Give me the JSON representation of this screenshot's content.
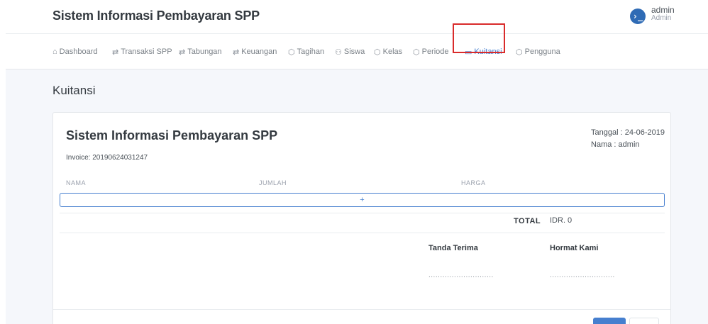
{
  "app": {
    "title": "Sistem Informasi Pembayaran SPP"
  },
  "user": {
    "avatar_glyph": "›_",
    "name": "admin",
    "role": "Admin"
  },
  "nav": {
    "items": [
      {
        "label": "Dashboard",
        "icon": "home-icon",
        "glyph": "⌂"
      },
      {
        "label": "Transaksi SPP",
        "icon": "repeat-icon",
        "glyph": "⇄"
      },
      {
        "label": "Tabungan",
        "icon": "repeat-icon",
        "glyph": "⇄"
      },
      {
        "label": "Keuangan",
        "icon": "repeat-icon",
        "glyph": "⇄"
      },
      {
        "label": "Tagihan",
        "icon": "box-icon",
        "glyph": "⬡"
      },
      {
        "label": "Siswa",
        "icon": "users-icon",
        "glyph": "⚇"
      },
      {
        "label": "Kelas",
        "icon": "box-icon",
        "glyph": "⬡"
      },
      {
        "label": "Periode",
        "icon": "box-icon",
        "glyph": "⬡"
      },
      {
        "label": "Kuitansi",
        "icon": "folder-icon",
        "glyph": "▭",
        "active": true
      },
      {
        "label": "Pengguna",
        "icon": "box-icon",
        "glyph": "⬡"
      }
    ],
    "active_color": "#467fcf",
    "highlight_color": "#d92b2b"
  },
  "page": {
    "title": "Kuitansi"
  },
  "invoice": {
    "title": "Sistem Informasi Pembayaran SPP",
    "number_line": "Invoice: 20190624031247",
    "date_line": "Tanggal : 24-06-2019",
    "name_line": "Nama : admin",
    "columns": [
      "NAMA",
      "JUMLAH",
      "HARGA"
    ],
    "add_row_label": "+",
    "total_label": "TOTAL",
    "total_value": "IDR. 0",
    "sign_received": "Tanda Terima",
    "sign_regards": "Hormat Kami",
    "sign_line": "............................"
  },
  "colors": {
    "primary": "#467fcf",
    "brand_avatar": "#2f6bb5"
  }
}
